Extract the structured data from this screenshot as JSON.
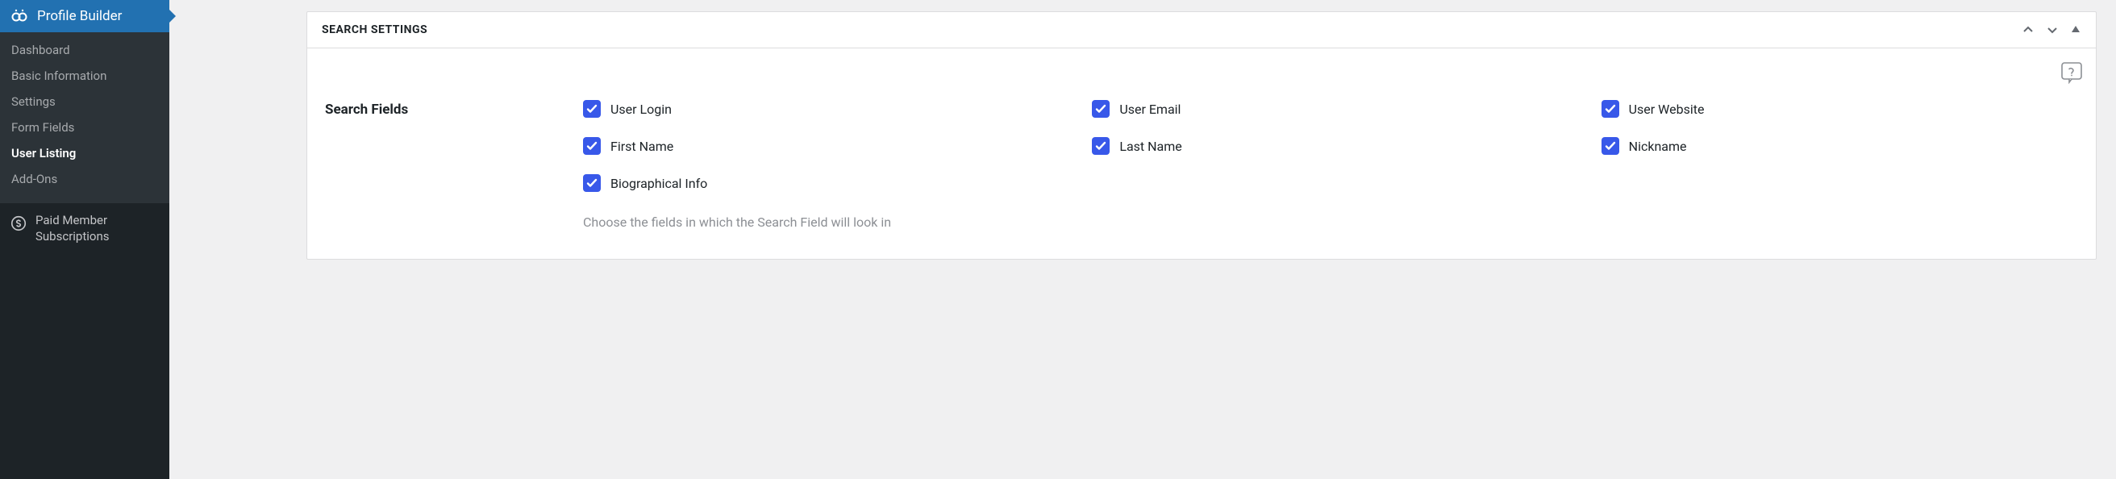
{
  "sidebar": {
    "header": "Profile Builder",
    "items": [
      {
        "label": "Dashboard",
        "active": false
      },
      {
        "label": "Basic Information",
        "active": false
      },
      {
        "label": "Settings",
        "active": false
      },
      {
        "label": "Form Fields",
        "active": false
      },
      {
        "label": "User Listing",
        "active": true
      },
      {
        "label": "Add-Ons",
        "active": false
      }
    ],
    "footer": "Paid Member Subscriptions"
  },
  "panel": {
    "title": "Search Settings",
    "field_label": "Search Fields",
    "description": "Choose the fields in which the Search Field will look in",
    "checkboxes": [
      {
        "label": "User Login",
        "checked": true
      },
      {
        "label": "User Email",
        "checked": true
      },
      {
        "label": "User Website",
        "checked": true
      },
      {
        "label": "First Name",
        "checked": true
      },
      {
        "label": "Last Name",
        "checked": true
      },
      {
        "label": "Nickname",
        "checked": true
      },
      {
        "label": "Biographical Info",
        "checked": true
      }
    ]
  }
}
